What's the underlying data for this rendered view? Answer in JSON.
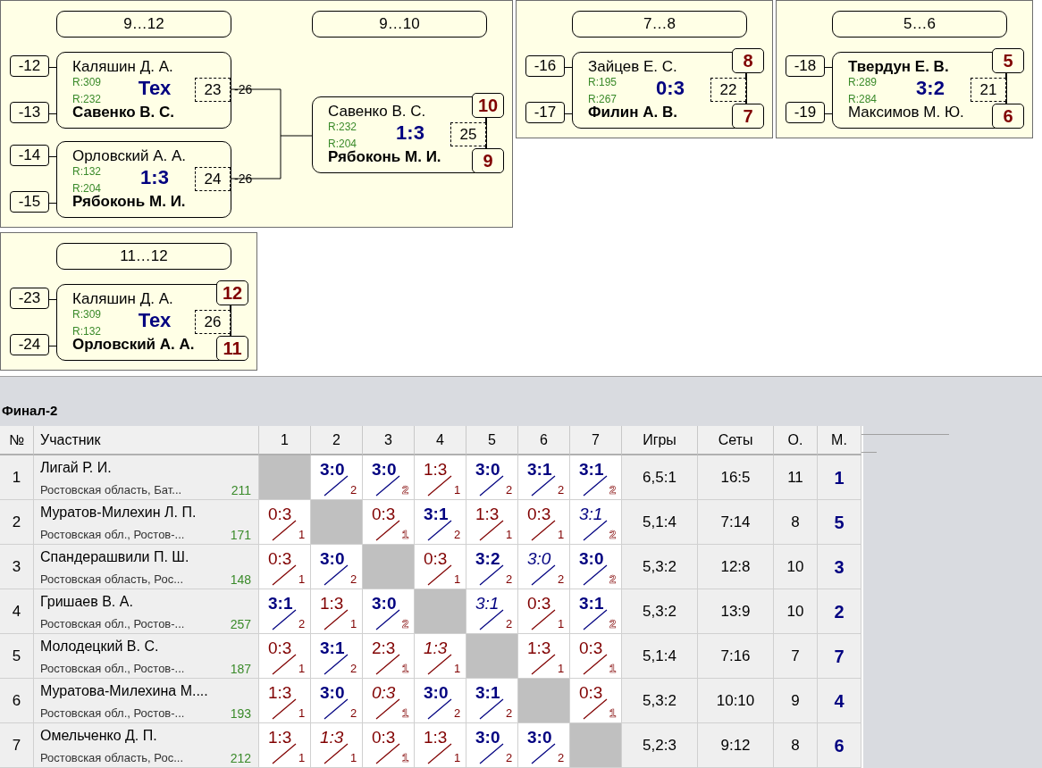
{
  "panels": [
    {
      "rounds": [
        {
          "title": "9…12",
          "matches": [
            {
              "number": "23",
              "score": "Тех",
              "loser_to": "-26",
              "players": [
                {
                  "name": "Каляшин Д. А.",
                  "rating": "R:309",
                  "winner": false,
                  "source": "-12"
                },
                {
                  "name": "Савенко В. С.",
                  "rating": "R:232",
                  "winner": true,
                  "source": "-13"
                }
              ]
            },
            {
              "number": "24",
              "score": "1:3",
              "loser_to": "-26",
              "players": [
                {
                  "name": "Орловский А. А.",
                  "rating": "R:132",
                  "winner": false,
                  "source": "-14"
                },
                {
                  "name": "Рябоконь М. И.",
                  "rating": "R:204",
                  "winner": true,
                  "source": "-15"
                }
              ]
            }
          ]
        },
        {
          "title": "9…10",
          "matches": [
            {
              "number": "25",
              "score": "1:3",
              "players": [
                {
                  "name": "Савенко В. С.",
                  "rating": "R:232",
                  "winner": false,
                  "place": "10"
                },
                {
                  "name": "Рябоконь М. И.",
                  "rating": "R:204",
                  "winner": true,
                  "place": "9"
                }
              ]
            }
          ]
        }
      ]
    },
    {
      "rounds": [
        {
          "title": "7…8",
          "matches": [
            {
              "number": "22",
              "score": "0:3",
              "players": [
                {
                  "name": "Зайцев Е. С.",
                  "rating": "R:195",
                  "winner": false,
                  "source": "-16",
                  "place": "8"
                },
                {
                  "name": "Филин А. В.",
                  "rating": "R:267",
                  "winner": true,
                  "source": "-17",
                  "place": "7"
                }
              ]
            }
          ]
        }
      ]
    },
    {
      "rounds": [
        {
          "title": "5…6",
          "matches": [
            {
              "number": "21",
              "score": "3:2",
              "players": [
                {
                  "name": "Твердун Е. В.",
                  "rating": "R:289",
                  "winner": true,
                  "source": "-18",
                  "place": "5"
                },
                {
                  "name": "Максимов М. Ю.",
                  "rating": "R:284",
                  "winner": false,
                  "source": "-19",
                  "place": "6"
                }
              ]
            }
          ]
        }
      ]
    },
    {
      "rounds": [
        {
          "title": "11…12",
          "matches": [
            {
              "number": "26",
              "score": "Тех",
              "players": [
                {
                  "name": "Каляшин Д. А.",
                  "rating": "R:309",
                  "winner": false,
                  "source": "-23",
                  "place": "12"
                },
                {
                  "name": "Орловский А. А.",
                  "rating": "R:132",
                  "winner": true,
                  "source": "-24",
                  "place": "11"
                }
              ]
            }
          ]
        }
      ]
    }
  ],
  "table": {
    "title": "Финал-2",
    "number_header": "№",
    "participant_header": "Участник",
    "opponent_columns": [
      "1",
      "2",
      "3",
      "4",
      "5",
      "6",
      "7"
    ],
    "stat_headers": [
      "Игры",
      "Сеты",
      "О.",
      "М."
    ],
    "rows": [
      {
        "num": "1",
        "name": "Лигай Р. И.",
        "region": "Ростовская область, Бат...",
        "rating": "211",
        "games": "6,5:1",
        "sets": "16:5",
        "points": "11",
        "place": "1",
        "cells": [
          {
            "kind": "self"
          },
          {
            "kind": "game",
            "score": "3:0",
            "points": "2",
            "won": true,
            "italic": false,
            "outline": false
          },
          {
            "kind": "game",
            "score": "3:0",
            "points": "2",
            "won": true,
            "italic": false,
            "outline": true
          },
          {
            "kind": "game",
            "score": "1:3",
            "points": "1",
            "won": false,
            "italic": false,
            "outline": false
          },
          {
            "kind": "game",
            "score": "3:0",
            "points": "2",
            "won": true,
            "italic": false,
            "outline": false
          },
          {
            "kind": "game",
            "score": "3:1",
            "points": "2",
            "won": true,
            "italic": false,
            "outline": false
          },
          {
            "kind": "game",
            "score": "3:1",
            "points": "2",
            "won": true,
            "italic": false,
            "outline": true
          }
        ]
      },
      {
        "num": "2",
        "name": "Муратов-Милехин Л. П.",
        "region": "Ростовская обл., Ростов-...",
        "rating": "171",
        "games": "5,1:4",
        "sets": "7:14",
        "points": "8",
        "place": "5",
        "cells": [
          {
            "kind": "game",
            "score": "0:3",
            "points": "1",
            "won": false,
            "italic": false,
            "outline": false
          },
          {
            "kind": "self"
          },
          {
            "kind": "game",
            "score": "0:3",
            "points": "1",
            "won": false,
            "italic": false,
            "outline": true
          },
          {
            "kind": "game",
            "score": "3:1",
            "points": "2",
            "won": true,
            "italic": false,
            "outline": false
          },
          {
            "kind": "game",
            "score": "1:3",
            "points": "1",
            "won": false,
            "italic": false,
            "outline": false
          },
          {
            "kind": "game",
            "score": "0:3",
            "points": "1",
            "won": false,
            "italic": false,
            "outline": false
          },
          {
            "kind": "game",
            "score": "3:1",
            "points": "2",
            "won": true,
            "italic": true,
            "outline": true
          }
        ]
      },
      {
        "num": "3",
        "name": "Спандерашвили П. Ш.",
        "region": "Ростовская область, Рос...",
        "rating": "148",
        "games": "5,3:2",
        "sets": "12:8",
        "points": "10",
        "place": "3",
        "cells": [
          {
            "kind": "game",
            "score": "0:3",
            "points": "1",
            "won": false,
            "italic": false,
            "outline": false
          },
          {
            "kind": "game",
            "score": "3:0",
            "points": "2",
            "won": true,
            "italic": false,
            "outline": false
          },
          {
            "kind": "self"
          },
          {
            "kind": "game",
            "score": "0:3",
            "points": "1",
            "won": false,
            "italic": false,
            "outline": false
          },
          {
            "kind": "game",
            "score": "3:2",
            "points": "2",
            "won": true,
            "italic": false,
            "outline": false
          },
          {
            "kind": "game",
            "score": "3:0",
            "points": "2",
            "won": true,
            "italic": true,
            "outline": false
          },
          {
            "kind": "game",
            "score": "3:0",
            "points": "2",
            "won": true,
            "italic": false,
            "outline": true
          }
        ]
      },
      {
        "num": "4",
        "name": "Гришаев В. А.",
        "region": "Ростовская обл., Ростов-...",
        "rating": "257",
        "games": "5,3:2",
        "sets": "13:9",
        "points": "10",
        "place": "2",
        "cells": [
          {
            "kind": "game",
            "score": "3:1",
            "points": "2",
            "won": true,
            "italic": false,
            "outline": false
          },
          {
            "kind": "game",
            "score": "1:3",
            "points": "1",
            "won": false,
            "italic": false,
            "outline": false
          },
          {
            "kind": "game",
            "score": "3:0",
            "points": "2",
            "won": true,
            "italic": false,
            "outline": true
          },
          {
            "kind": "self"
          },
          {
            "kind": "game",
            "score": "3:1",
            "points": "2",
            "won": true,
            "italic": true,
            "outline": false
          },
          {
            "kind": "game",
            "score": "0:3",
            "points": "1",
            "won": false,
            "italic": false,
            "outline": false
          },
          {
            "kind": "game",
            "score": "3:1",
            "points": "2",
            "won": true,
            "italic": false,
            "outline": true
          }
        ]
      },
      {
        "num": "5",
        "name": "Молодецкий В. С.",
        "region": "Ростовская обл., Ростов-...",
        "rating": "187",
        "games": "5,1:4",
        "sets": "7:16",
        "points": "7",
        "place": "7",
        "cells": [
          {
            "kind": "game",
            "score": "0:3",
            "points": "1",
            "won": false,
            "italic": false,
            "outline": false
          },
          {
            "kind": "game",
            "score": "3:1",
            "points": "2",
            "won": true,
            "italic": false,
            "outline": false
          },
          {
            "kind": "game",
            "score": "2:3",
            "points": "1",
            "won": false,
            "italic": false,
            "outline": true
          },
          {
            "kind": "game",
            "score": "1:3",
            "points": "1",
            "won": false,
            "italic": true,
            "outline": false
          },
          {
            "kind": "self"
          },
          {
            "kind": "game",
            "score": "1:3",
            "points": "1",
            "won": false,
            "italic": false,
            "outline": false
          },
          {
            "kind": "game",
            "score": "0:3",
            "points": "1",
            "won": false,
            "italic": false,
            "outline": true
          }
        ]
      },
      {
        "num": "6",
        "name": "Муратова-Милехина М....",
        "region": "Ростовская обл., Ростов-...",
        "rating": "193",
        "games": "5,3:2",
        "sets": "10:10",
        "points": "9",
        "place": "4",
        "cells": [
          {
            "kind": "game",
            "score": "1:3",
            "points": "1",
            "won": false,
            "italic": false,
            "outline": false
          },
          {
            "kind": "game",
            "score": "3:0",
            "points": "2",
            "won": true,
            "italic": false,
            "outline": false
          },
          {
            "kind": "game",
            "score": "0:3",
            "points": "1",
            "won": false,
            "italic": true,
            "outline": true
          },
          {
            "kind": "game",
            "score": "3:0",
            "points": "2",
            "won": true,
            "italic": false,
            "outline": false
          },
          {
            "kind": "game",
            "score": "3:1",
            "points": "2",
            "won": true,
            "italic": false,
            "outline": false
          },
          {
            "kind": "self"
          },
          {
            "kind": "game",
            "score": "0:3",
            "points": "1",
            "won": false,
            "italic": false,
            "outline": true
          }
        ]
      },
      {
        "num": "7",
        "name": "Омельченко Д. П.",
        "region": "Ростовская область, Рос...",
        "rating": "212",
        "games": "5,2:3",
        "sets": "9:12",
        "points": "8",
        "place": "6",
        "cells": [
          {
            "kind": "game",
            "score": "1:3",
            "points": "1",
            "won": false,
            "italic": false,
            "outline": false
          },
          {
            "kind": "game",
            "score": "1:3",
            "points": "1",
            "won": false,
            "italic": true,
            "outline": false
          },
          {
            "kind": "game",
            "score": "0:3",
            "points": "1",
            "won": false,
            "italic": false,
            "outline": true
          },
          {
            "kind": "game",
            "score": "1:3",
            "points": "1",
            "won": false,
            "italic": false,
            "outline": false
          },
          {
            "kind": "game",
            "score": "3:0",
            "points": "2",
            "won": true,
            "italic": false,
            "outline": false
          },
          {
            "kind": "game",
            "score": "3:0",
            "points": "2",
            "won": true,
            "italic": false,
            "outline": false
          },
          {
            "kind": "self"
          }
        ]
      }
    ]
  }
}
